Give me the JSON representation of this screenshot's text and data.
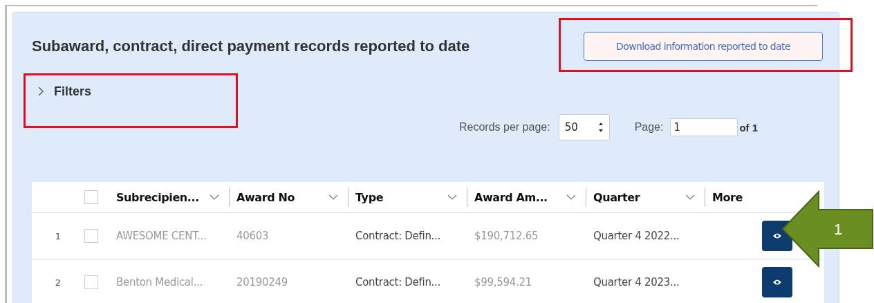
{
  "title": "Subaward, contract, direct payment records reported to date",
  "download_button": {
    "label": "Download information reported to date",
    "highlighted": true
  },
  "filters": {
    "label": "Filters",
    "expanded": false,
    "highlighted": true
  },
  "pagination": {
    "records_label": "Records per page:",
    "records_value": "50",
    "page_label": "Page:",
    "page_value": "1",
    "page_total": "of 1"
  },
  "table": {
    "select_all_checked": false,
    "columns": [
      {
        "label": "Subrecipien...",
        "sortable": true
      },
      {
        "label": "Award No",
        "sortable": true
      },
      {
        "label": "Type",
        "sortable": true
      },
      {
        "label": "Award Am...",
        "sortable": true
      },
      {
        "label": "Quarter",
        "sortable": true
      },
      {
        "label": "More",
        "sortable": false
      }
    ],
    "rows": [
      {
        "index": "1",
        "checked": false,
        "cells": [
          "AWESOME CENT...",
          "40603",
          "Contract: Defin...",
          "$190,712.65",
          "Quarter 4 2022..."
        ]
      },
      {
        "index": "2",
        "checked": false,
        "cells": [
          "Benton Medical...",
          "20190249",
          "Contract: Defin...",
          "$99,594.21",
          "Quarter 4 2023..."
        ]
      }
    ]
  },
  "callout": {
    "label": "1"
  }
}
